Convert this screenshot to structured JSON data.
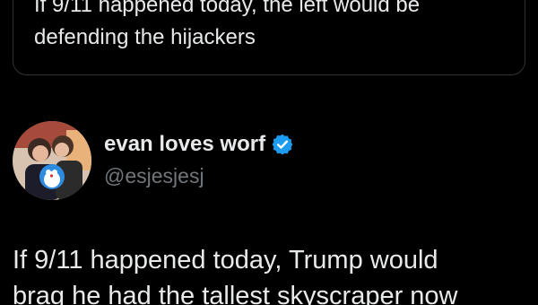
{
  "quoted_tweet": {
    "text": "If 9/11 happened today, the left would be\ndefending the hijackers"
  },
  "author": {
    "display_name": "evan loves worf",
    "handle": "@esjesjesj",
    "avatar_icon": "profile-photo",
    "verified_icon": "verified-badge-icon"
  },
  "tweet": {
    "text": "If 9/11 happened today, Trump would\nbrag he had the tallest skyscraper now"
  },
  "colors": {
    "background": "#000000",
    "text": "#e7e9ea",
    "secondary_text": "#71767b",
    "border": "#2f3336",
    "verified": "#1d9bf0"
  }
}
